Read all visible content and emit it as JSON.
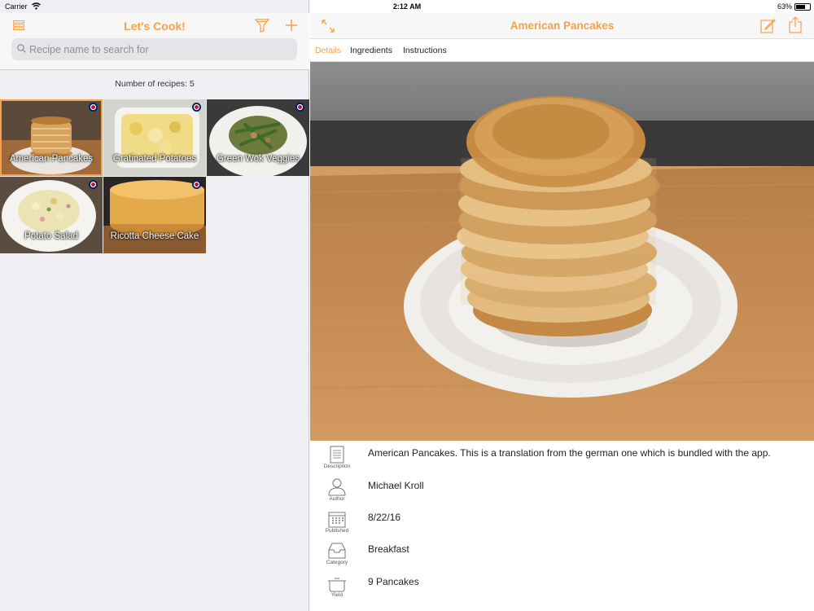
{
  "status_bar": {
    "carrier": "Carrier",
    "time": "2:12 AM",
    "battery": "63%",
    "battery_level": 0.63
  },
  "left": {
    "title": "Let's Cook!",
    "search_placeholder": "Recipe name to search for",
    "count_text": "Number of recipes: 5",
    "recipes": [
      {
        "name": "American Pancakes",
        "selected": true
      },
      {
        "name": "Gratinated Potatoes",
        "selected": false
      },
      {
        "name": "Green Wok Veggies",
        "selected": false
      },
      {
        "name": "Potato Salad",
        "selected": false
      },
      {
        "name": "Ricotta Cheese Cake",
        "selected": false
      }
    ]
  },
  "right": {
    "title": "American Pancakes",
    "tabs": [
      "Details",
      "Ingredients",
      "Instructions"
    ],
    "active_tab": "Details",
    "details": [
      {
        "caption": "Description",
        "icon": "document-icon",
        "value": "American Pancakes. This is a translation from the german one which is bundled with the app."
      },
      {
        "caption": "Author",
        "icon": "person-icon",
        "value": "Michael Kroll"
      },
      {
        "caption": "Published",
        "icon": "calendar-icon",
        "value": "8/22/16"
      },
      {
        "caption": "Category",
        "icon": "tray-icon",
        "value": "Breakfast"
      },
      {
        "caption": "Yield",
        "icon": "pot-icon",
        "value": "9 Pancakes"
      }
    ]
  },
  "colors": {
    "accent": "#f5a14a",
    "sidebar_bg": "#efeff4",
    "nav_bg": "#f7f7f7"
  }
}
